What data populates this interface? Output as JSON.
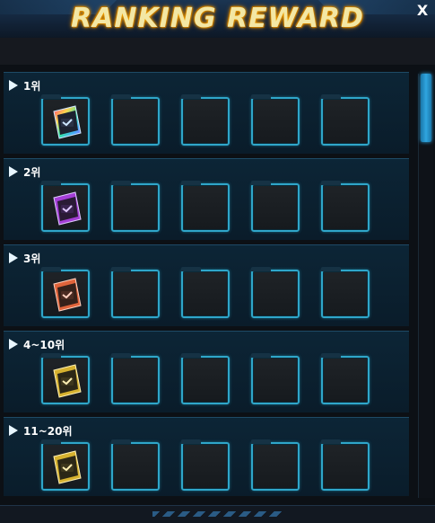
{
  "header": {
    "title": "RANKING REWARD",
    "close_label": "X"
  },
  "rows": [
    {
      "rank": "1위",
      "item_color": "rainbow-card"
    },
    {
      "rank": "2위",
      "item_color": "purple-card"
    },
    {
      "rank": "3위",
      "item_color": "orange-card"
    },
    {
      "rank": "4~10위",
      "item_color": "gold-card"
    },
    {
      "rank": "11~20위",
      "item_color": "gold-card"
    }
  ],
  "colors": {
    "accent": "#2fa6c9",
    "title_glow": "#ffb300",
    "rainbow": [
      "#ff3a7a",
      "#ffd34d",
      "#33e8a1",
      "#4aa7ff",
      "#b15bff"
    ],
    "purple": "#a43ed6",
    "orange": "#e0643b",
    "gold": "#d6b12f"
  }
}
